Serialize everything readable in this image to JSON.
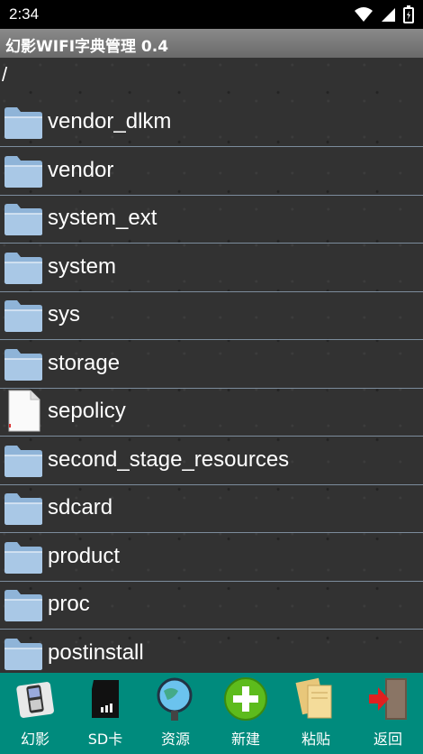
{
  "status_bar": {
    "time": "2:34"
  },
  "app": {
    "title": "幻影WIFI字典管理 0.4"
  },
  "path": "/",
  "files": [
    {
      "name": "vendor_dlkm",
      "type": "folder"
    },
    {
      "name": "vendor",
      "type": "folder"
    },
    {
      "name": "system_ext",
      "type": "folder"
    },
    {
      "name": "system",
      "type": "folder"
    },
    {
      "name": "sys",
      "type": "folder"
    },
    {
      "name": "storage",
      "type": "folder"
    },
    {
      "name": "sepolicy",
      "type": "file"
    },
    {
      "name": "second_stage_resources",
      "type": "folder"
    },
    {
      "name": "sdcard",
      "type": "folder"
    },
    {
      "name": "product",
      "type": "folder"
    },
    {
      "name": "proc",
      "type": "folder"
    },
    {
      "name": "postinstall",
      "type": "folder"
    }
  ],
  "toolbar": {
    "phantom": "幻影",
    "sdcard": "SD卡",
    "resources": "资源",
    "new": "新建",
    "paste": "粘贴",
    "back": "返回"
  },
  "colors": {
    "toolbar_bg": "#008b7d",
    "title_bg": "#7a7a7a",
    "divider": "#7c8c9c"
  }
}
